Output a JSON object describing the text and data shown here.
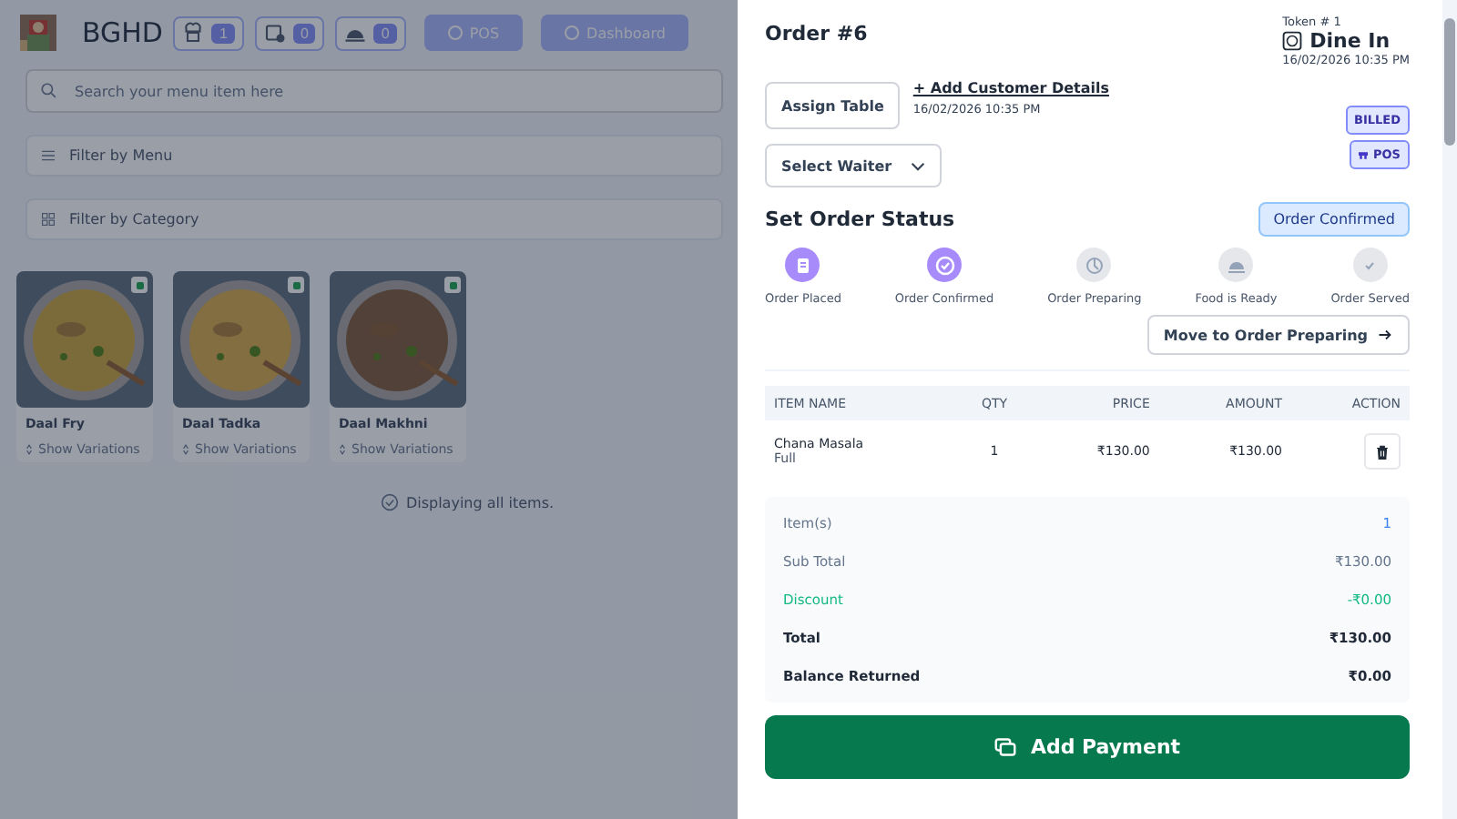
{
  "header": {
    "brand": "BGHD",
    "counters": [
      {
        "count": "1"
      },
      {
        "count": "0"
      },
      {
        "count": "0"
      }
    ],
    "nav_buttons": [
      "POS",
      "Dashboard"
    ]
  },
  "search": {
    "placeholder": "Search your menu item here"
  },
  "filters": [
    {
      "label": "Filter by Menu"
    },
    {
      "label": "Filter by Category"
    }
  ],
  "menu_items": [
    {
      "name": "Daal Fry",
      "variations": "Show Variations",
      "veg": true
    },
    {
      "name": "Daal Tadka",
      "variations": "Show Variations",
      "veg": true
    },
    {
      "name": "Daal Makhni",
      "variations": "Show Variations",
      "veg": true
    }
  ],
  "list_status": "Displaying all items.",
  "order": {
    "title": "Order #6",
    "token": "Token # 1",
    "type": "Dine In",
    "datetime": "16/02/2026 10:35 PM",
    "assign_table": "Assign Table",
    "add_customer": "+ Add Customer Details",
    "customer_datetime": "16/02/2026 10:35 PM",
    "badges": [
      {
        "label": "BILLED",
        "icon": false
      },
      {
        "label": "POS",
        "icon": true
      }
    ],
    "waiter": {
      "placeholder": "Select Waiter"
    },
    "status_title": "Set Order Status",
    "current_status": "Order Confirmed",
    "steps": [
      {
        "label": "Order Placed",
        "done": true
      },
      {
        "label": "Order Confirmed",
        "done": true
      },
      {
        "label": "Order Preparing",
        "done": false
      },
      {
        "label": "Food is Ready",
        "done": false
      },
      {
        "label": "Order Served",
        "done": false
      }
    ],
    "next_button": "Move to Order Preparing",
    "columns": [
      "ITEM NAME",
      "QTY",
      "PRICE",
      "AMOUNT",
      "ACTION"
    ],
    "items": [
      {
        "name": "Chana Masala",
        "variant": "Full",
        "qty": "1",
        "price": "₹130.00",
        "amount": "₹130.00"
      }
    ],
    "summary": [
      {
        "label": "Item(s)",
        "value": "1",
        "kind": "count"
      },
      {
        "label": "Sub Total",
        "value": "₹130.00",
        "kind": "plain"
      },
      {
        "label": "Discount",
        "value": "-₹0.00",
        "kind": "discount"
      },
      {
        "label": "Total",
        "value": "₹130.00",
        "kind": "bold"
      },
      {
        "label": "Balance Returned",
        "value": "₹0.00",
        "kind": "bold"
      }
    ],
    "pay_button": "Add Payment"
  }
}
